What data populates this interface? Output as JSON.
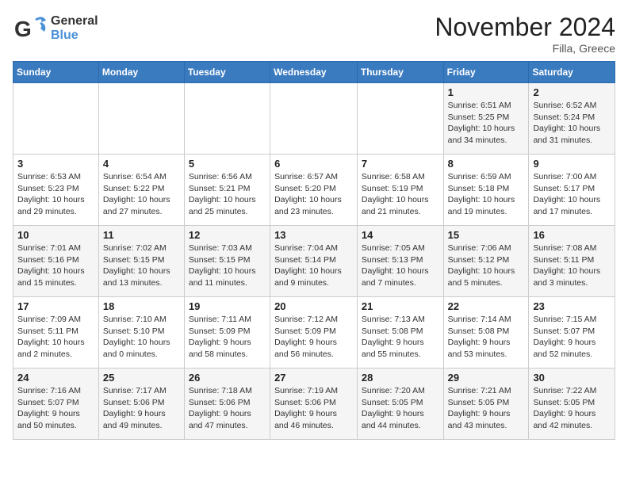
{
  "header": {
    "logo_general": "General",
    "logo_blue": "Blue",
    "month_title": "November 2024",
    "location": "Filla, Greece"
  },
  "weekdays": [
    "Sunday",
    "Monday",
    "Tuesday",
    "Wednesday",
    "Thursday",
    "Friday",
    "Saturday"
  ],
  "weeks": [
    [
      {
        "day": "",
        "info": ""
      },
      {
        "day": "",
        "info": ""
      },
      {
        "day": "",
        "info": ""
      },
      {
        "day": "",
        "info": ""
      },
      {
        "day": "",
        "info": ""
      },
      {
        "day": "1",
        "info": "Sunrise: 6:51 AM\nSunset: 5:25 PM\nDaylight: 10 hours and 34 minutes."
      },
      {
        "day": "2",
        "info": "Sunrise: 6:52 AM\nSunset: 5:24 PM\nDaylight: 10 hours and 31 minutes."
      }
    ],
    [
      {
        "day": "3",
        "info": "Sunrise: 6:53 AM\nSunset: 5:23 PM\nDaylight: 10 hours and 29 minutes."
      },
      {
        "day": "4",
        "info": "Sunrise: 6:54 AM\nSunset: 5:22 PM\nDaylight: 10 hours and 27 minutes."
      },
      {
        "day": "5",
        "info": "Sunrise: 6:56 AM\nSunset: 5:21 PM\nDaylight: 10 hours and 25 minutes."
      },
      {
        "day": "6",
        "info": "Sunrise: 6:57 AM\nSunset: 5:20 PM\nDaylight: 10 hours and 23 minutes."
      },
      {
        "day": "7",
        "info": "Sunrise: 6:58 AM\nSunset: 5:19 PM\nDaylight: 10 hours and 21 minutes."
      },
      {
        "day": "8",
        "info": "Sunrise: 6:59 AM\nSunset: 5:18 PM\nDaylight: 10 hours and 19 minutes."
      },
      {
        "day": "9",
        "info": "Sunrise: 7:00 AM\nSunset: 5:17 PM\nDaylight: 10 hours and 17 minutes."
      }
    ],
    [
      {
        "day": "10",
        "info": "Sunrise: 7:01 AM\nSunset: 5:16 PM\nDaylight: 10 hours and 15 minutes."
      },
      {
        "day": "11",
        "info": "Sunrise: 7:02 AM\nSunset: 5:15 PM\nDaylight: 10 hours and 13 minutes."
      },
      {
        "day": "12",
        "info": "Sunrise: 7:03 AM\nSunset: 5:15 PM\nDaylight: 10 hours and 11 minutes."
      },
      {
        "day": "13",
        "info": "Sunrise: 7:04 AM\nSunset: 5:14 PM\nDaylight: 10 hours and 9 minutes."
      },
      {
        "day": "14",
        "info": "Sunrise: 7:05 AM\nSunset: 5:13 PM\nDaylight: 10 hours and 7 minutes."
      },
      {
        "day": "15",
        "info": "Sunrise: 7:06 AM\nSunset: 5:12 PM\nDaylight: 10 hours and 5 minutes."
      },
      {
        "day": "16",
        "info": "Sunrise: 7:08 AM\nSunset: 5:11 PM\nDaylight: 10 hours and 3 minutes."
      }
    ],
    [
      {
        "day": "17",
        "info": "Sunrise: 7:09 AM\nSunset: 5:11 PM\nDaylight: 10 hours and 2 minutes."
      },
      {
        "day": "18",
        "info": "Sunrise: 7:10 AM\nSunset: 5:10 PM\nDaylight: 10 hours and 0 minutes."
      },
      {
        "day": "19",
        "info": "Sunrise: 7:11 AM\nSunset: 5:09 PM\nDaylight: 9 hours and 58 minutes."
      },
      {
        "day": "20",
        "info": "Sunrise: 7:12 AM\nSunset: 5:09 PM\nDaylight: 9 hours and 56 minutes."
      },
      {
        "day": "21",
        "info": "Sunrise: 7:13 AM\nSunset: 5:08 PM\nDaylight: 9 hours and 55 minutes."
      },
      {
        "day": "22",
        "info": "Sunrise: 7:14 AM\nSunset: 5:08 PM\nDaylight: 9 hours and 53 minutes."
      },
      {
        "day": "23",
        "info": "Sunrise: 7:15 AM\nSunset: 5:07 PM\nDaylight: 9 hours and 52 minutes."
      }
    ],
    [
      {
        "day": "24",
        "info": "Sunrise: 7:16 AM\nSunset: 5:07 PM\nDaylight: 9 hours and 50 minutes."
      },
      {
        "day": "25",
        "info": "Sunrise: 7:17 AM\nSunset: 5:06 PM\nDaylight: 9 hours and 49 minutes."
      },
      {
        "day": "26",
        "info": "Sunrise: 7:18 AM\nSunset: 5:06 PM\nDaylight: 9 hours and 47 minutes."
      },
      {
        "day": "27",
        "info": "Sunrise: 7:19 AM\nSunset: 5:06 PM\nDaylight: 9 hours and 46 minutes."
      },
      {
        "day": "28",
        "info": "Sunrise: 7:20 AM\nSunset: 5:05 PM\nDaylight: 9 hours and 44 minutes."
      },
      {
        "day": "29",
        "info": "Sunrise: 7:21 AM\nSunset: 5:05 PM\nDaylight: 9 hours and 43 minutes."
      },
      {
        "day": "30",
        "info": "Sunrise: 7:22 AM\nSunset: 5:05 PM\nDaylight: 9 hours and 42 minutes."
      }
    ]
  ]
}
